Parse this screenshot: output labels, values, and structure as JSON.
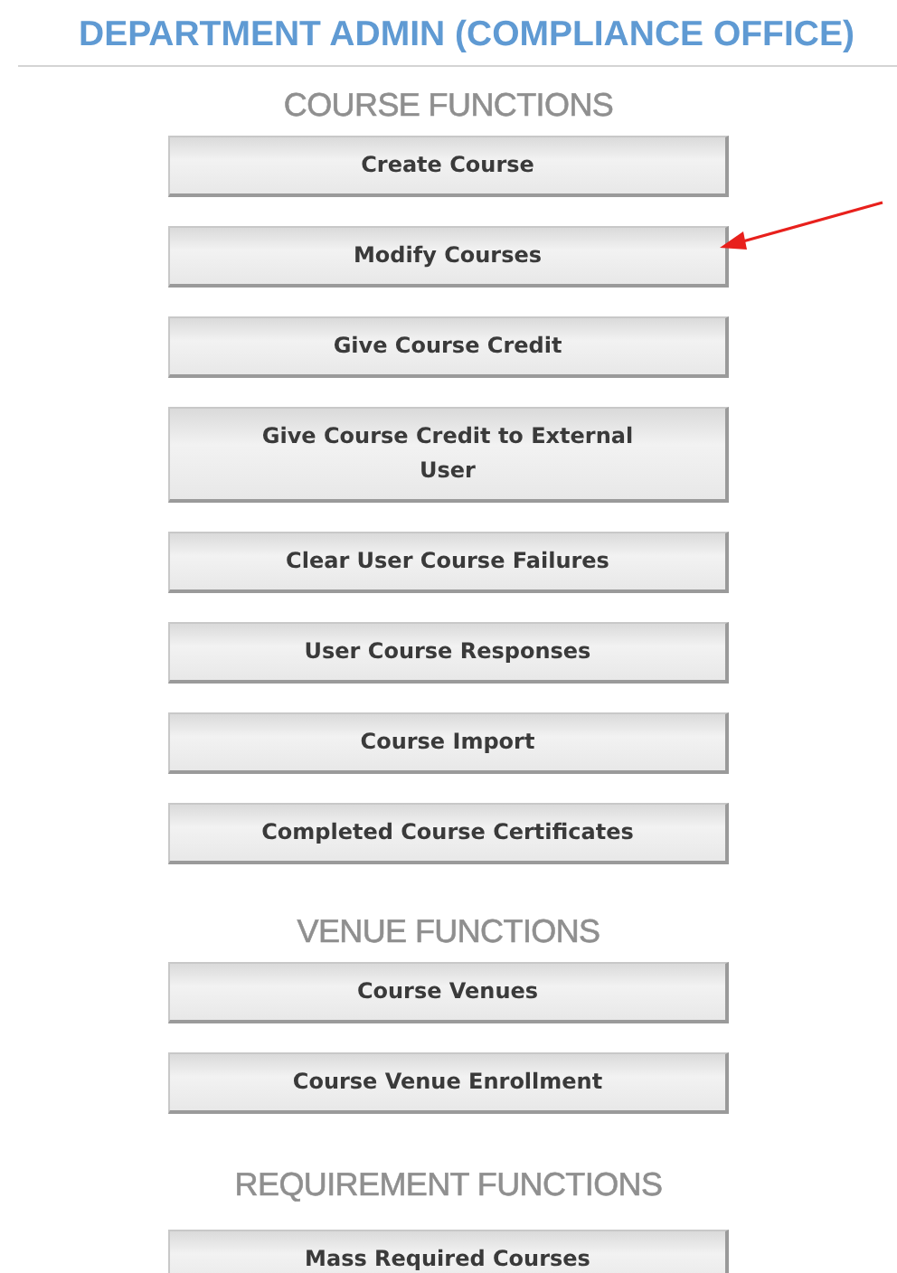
{
  "title": "DEPARTMENT ADMIN (COMPLIANCE OFFICE)",
  "sections": [
    {
      "heading": "COURSE FUNCTIONS",
      "buttons": [
        {
          "label": "Create Course",
          "pointed": false
        },
        {
          "label": "Modify Courses",
          "pointed": true
        },
        {
          "label": "Give Course Credit",
          "pointed": false
        },
        {
          "label": "Give Course Credit to External User",
          "pointed": false
        },
        {
          "label": "Clear User Course Failures",
          "pointed": false
        },
        {
          "label": "User Course Responses",
          "pointed": false
        },
        {
          "label": "Course Import",
          "pointed": false
        },
        {
          "label": "Completed Course Certificates",
          "pointed": false
        }
      ]
    },
    {
      "heading": "VENUE FUNCTIONS",
      "buttons": [
        {
          "label": "Course Venues",
          "pointed": false
        },
        {
          "label": "Course Venue Enrollment",
          "pointed": false
        }
      ]
    },
    {
      "heading": "REQUIREMENT FUNCTIONS",
      "buttons": [
        {
          "label": "Mass Required Courses",
          "pointed": false
        }
      ]
    }
  ]
}
